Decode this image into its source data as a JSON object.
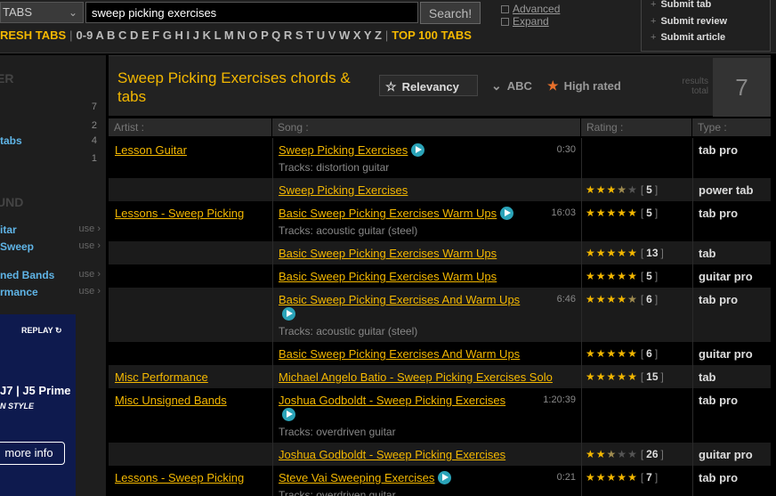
{
  "header": {
    "type_select": "TABS",
    "search_value": "sweep picking exercises",
    "search_button": "Search!",
    "advanced": "Advanced",
    "expand": "Expand",
    "submit_tab": "Submit tab",
    "submit_review": "Submit review",
    "submit_article": "Submit article",
    "fresh_tabs": "RESH TABS",
    "alphabet": "0-9 A B C D E F G H I J K L M N O P Q R S T U V W X Y Z",
    "top100": "TOP 100 TABS"
  },
  "sidebar": {
    "head1": "ER",
    "counts": [
      "7",
      "2",
      "4",
      "1"
    ],
    "tabs_label": "tabs",
    "head2": "UND",
    "links": [
      {
        "label": "itar",
        "use": "use"
      },
      {
        "label": "Sweep",
        "use": "use"
      },
      {
        "label": "ned Bands",
        "use": "use"
      },
      {
        "label": "rmance",
        "use": "use"
      }
    ],
    "ad": {
      "replay": "REPLAY",
      "model": "J7 | J5 Prime",
      "style": "N STYLE",
      "more": "more info"
    }
  },
  "main": {
    "title": "Sweep Picking Exercises chords & tabs",
    "sort_relevancy": "Relevancy",
    "sort_abc": "ABC",
    "sort_rated": "High rated",
    "results_label": "results total",
    "results_total": "7",
    "columns": [
      "Artist :",
      "Song :",
      "Rating :",
      "Type :"
    ]
  },
  "rows": [
    {
      "artist": "Lesson Guitar",
      "song": "Sweep Picking Exercises",
      "play": true,
      "duration": "0:30",
      "tracks": "Tracks: distortion guitar",
      "stars": 0,
      "votes": "",
      "type": "tab pro"
    },
    {
      "artist": "",
      "song": "Sweep Picking Exercises",
      "play": false,
      "duration": "",
      "tracks": "",
      "stars": 3.5,
      "votes": "5",
      "type": "power tab"
    },
    {
      "artist": "Lessons - Sweep Picking",
      "song": "Basic Sweep Picking Exercises Warm Ups",
      "play": true,
      "duration": "16:03",
      "tracks": "Tracks: acoustic guitar (steel)",
      "stars": 5,
      "votes": "5",
      "type": "tab pro"
    },
    {
      "artist": "",
      "song": "Basic Sweep Picking Exercises Warm Ups",
      "play": false,
      "duration": "",
      "tracks": "",
      "stars": 5,
      "votes": "13",
      "type": "tab"
    },
    {
      "artist": "",
      "song": "Basic Sweep Picking Exercises Warm Ups",
      "play": false,
      "duration": "",
      "tracks": "",
      "stars": 5,
      "votes": "5",
      "type": "guitar pro"
    },
    {
      "artist": "",
      "song": "Basic Sweep Picking Exercises And Warm Ups",
      "play": true,
      "duration": "6:46",
      "tracks": "Tracks: acoustic guitar (steel)",
      "stars": 4.5,
      "votes": "6",
      "type": "tab pro"
    },
    {
      "artist": "",
      "song": "Basic Sweep Picking Exercises And Warm Ups",
      "play": false,
      "duration": "",
      "tracks": "",
      "stars": 5,
      "votes": "6",
      "type": "guitar pro"
    },
    {
      "artist": "Misc Performance",
      "song": "Michael Angelo Batio - Sweep Picking Exercises Solo",
      "play": false,
      "duration": "",
      "tracks": "",
      "stars": 5,
      "votes": "15",
      "type": "tab"
    },
    {
      "artist": "Misc Unsigned Bands",
      "song": "Joshua Godboldt - Sweep Picking Exercises",
      "play": true,
      "duration": "1:20:39",
      "tracks": "Tracks: overdriven guitar",
      "stars": 0,
      "votes": "",
      "type": "tab pro"
    },
    {
      "artist": "",
      "song": "Joshua Godboldt - Sweep Picking Exercises",
      "play": false,
      "duration": "",
      "tracks": "",
      "stars": 2.5,
      "votes": "26",
      "type": "guitar pro"
    },
    {
      "artist": "Lessons - Sweep Picking",
      "song": "Steve Vai Sweeping Exercises",
      "play": true,
      "duration": "0:21",
      "tracks": "Tracks: overdriven guitar",
      "stars": 5,
      "votes": "7",
      "type": "tab pro"
    }
  ]
}
